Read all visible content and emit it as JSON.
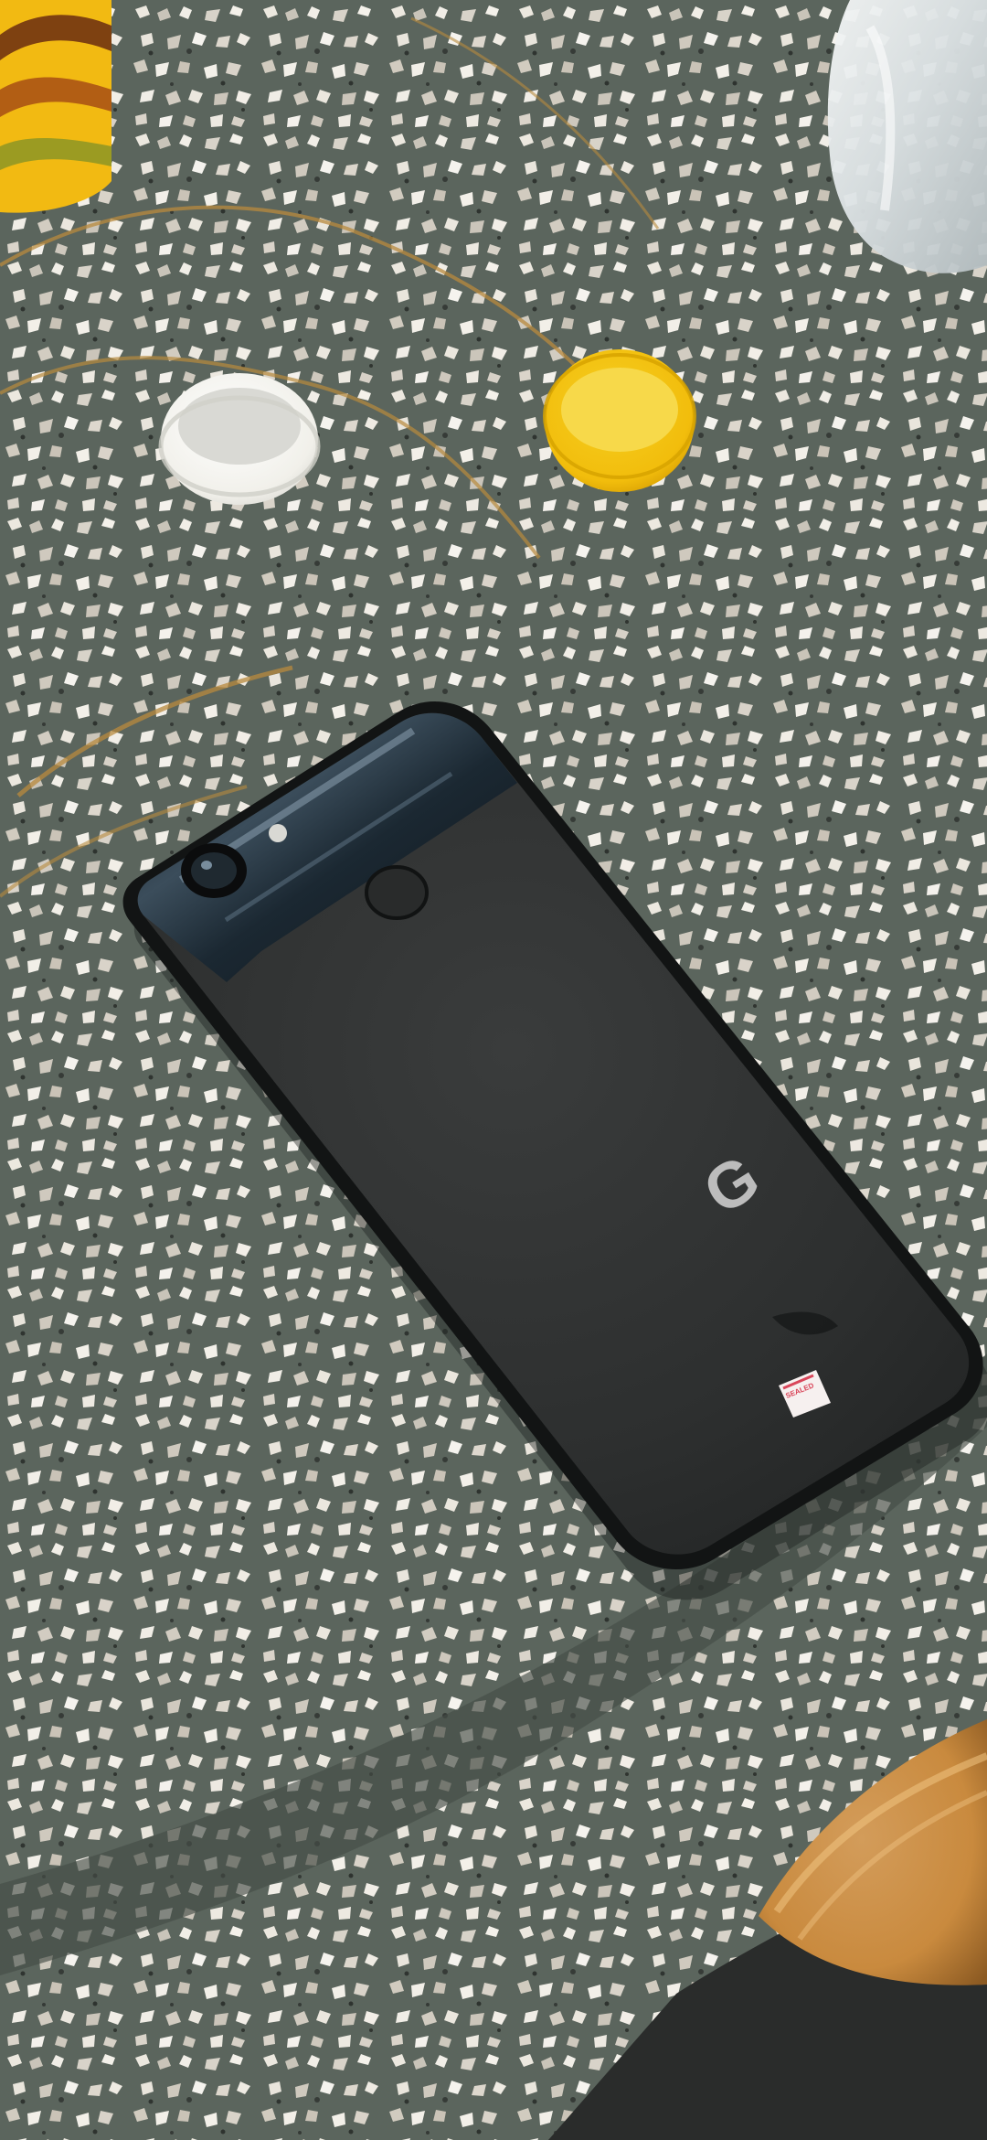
{
  "scene": {
    "subject": "phone-back-on-terrazzo-table",
    "colors": {
      "table": "#5b655d",
      "table_dark": "#434b45",
      "chip_light": "#e9e7df",
      "chip_mid": "#c7c2b6",
      "phone_body": "#2f3131",
      "phone_glass": "#1c2a35",
      "phone_edge": "#0f1112",
      "cap_white": "#f1f0ea",
      "cap_yellow": "#f2c10c",
      "rust_line": "#b88a3d",
      "basket": "#c98a3e",
      "floor": "#2a2c2b"
    }
  },
  "phone_logo": "G",
  "sticker_text": "SEALED"
}
